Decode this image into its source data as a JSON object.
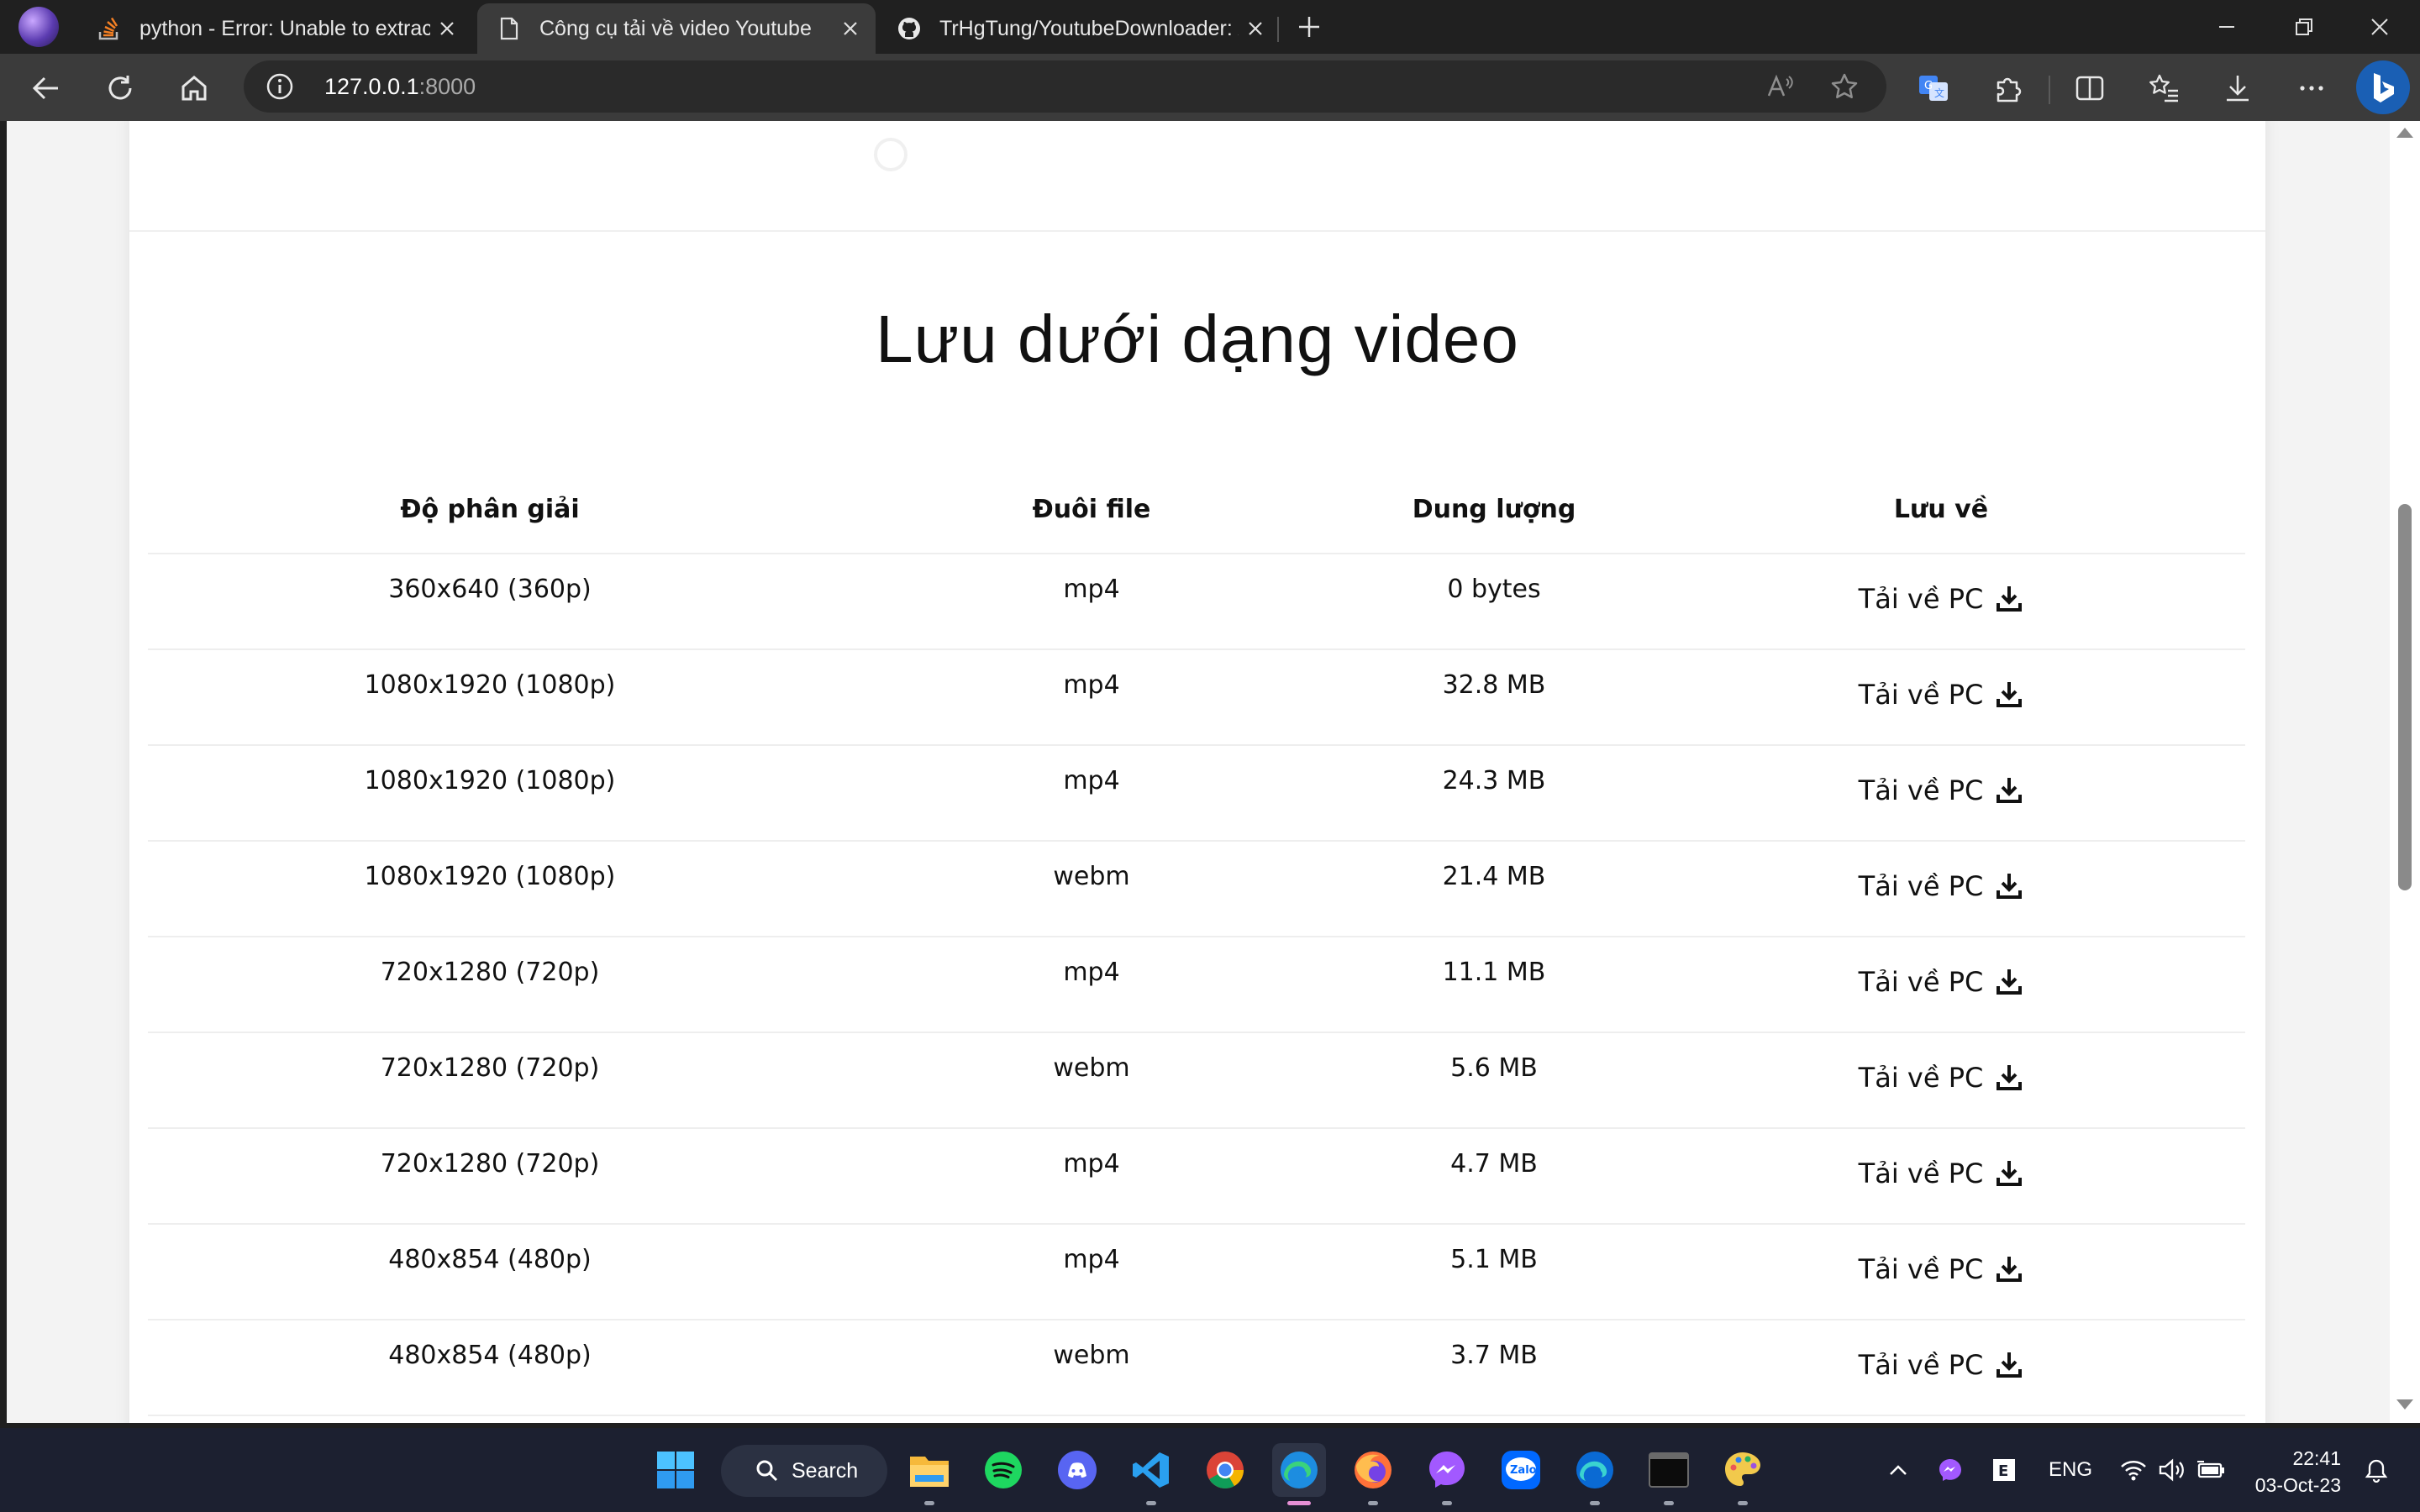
{
  "browser": {
    "tabs": [
      {
        "title": "python - Error: Unable to extract",
        "icon": "stackoverflow-icon",
        "active": false
      },
      {
        "title": "Công cụ tải về video Youtube",
        "icon": "page-icon",
        "active": true
      },
      {
        "title": "TrHgTung/YoutubeDownloader: /",
        "icon": "github-icon",
        "active": false
      }
    ],
    "url_host": "127.0.0.1",
    "url_port": ":8000"
  },
  "page": {
    "section_title": "Lưu dưới dạng video",
    "table": {
      "headers": [
        "Độ phân giải",
        "Đuôi file",
        "Dung lượng",
        "Lưu về"
      ],
      "rows": [
        {
          "resolution": "360x640 (360p)",
          "ext": "mp4",
          "size": "0 bytes",
          "action": "Tải về PC"
        },
        {
          "resolution": "1080x1920 (1080p)",
          "ext": "mp4",
          "size": "32.8 MB",
          "action": "Tải về PC"
        },
        {
          "resolution": "1080x1920 (1080p)",
          "ext": "mp4",
          "size": "24.3 MB",
          "action": "Tải về PC"
        },
        {
          "resolution": "1080x1920 (1080p)",
          "ext": "webm",
          "size": "21.4 MB",
          "action": "Tải về PC"
        },
        {
          "resolution": "720x1280 (720p)",
          "ext": "mp4",
          "size": "11.1 MB",
          "action": "Tải về PC"
        },
        {
          "resolution": "720x1280 (720p)",
          "ext": "webm",
          "size": "5.6 MB",
          "action": "Tải về PC"
        },
        {
          "resolution": "720x1280 (720p)",
          "ext": "mp4",
          "size": "4.7 MB",
          "action": "Tải về PC"
        },
        {
          "resolution": "480x854 (480p)",
          "ext": "mp4",
          "size": "5.1 MB",
          "action": "Tải về PC"
        },
        {
          "resolution": "480x854 (480p)",
          "ext": "webm",
          "size": "3.7 MB",
          "action": "Tải về PC"
        }
      ]
    }
  },
  "taskbar": {
    "search_label": "Search",
    "language": "ENG",
    "time": "22:41",
    "date": "03-Oct-23"
  },
  "colors": {
    "chrome_dark": "#202020",
    "toolbar": "#3b3b3b",
    "taskbar": "#1c2030",
    "page_bg": "#ffffff",
    "text": "#111111"
  }
}
